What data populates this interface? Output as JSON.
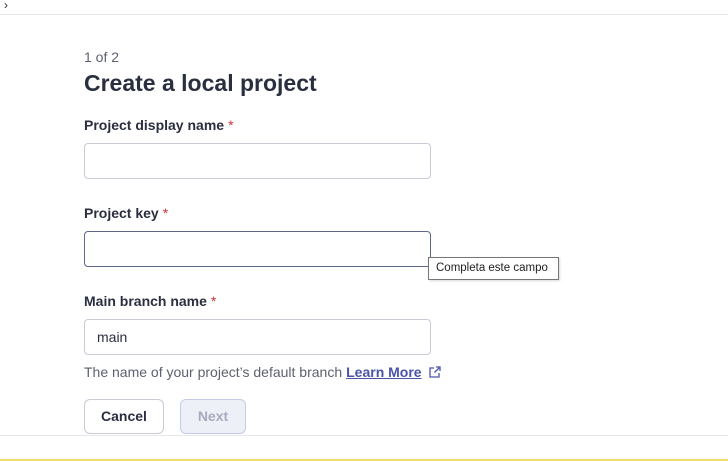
{
  "header": {
    "stub_glyph": "›"
  },
  "wizard": {
    "step": "1 of 2",
    "title": "Create a local project"
  },
  "fields": {
    "display_name": {
      "label": "Project display name",
      "required_mark": "*",
      "value": ""
    },
    "project_key": {
      "label": "Project key",
      "required_mark": "*",
      "value": "",
      "tooltip": "Completa este campo"
    },
    "main_branch": {
      "label": "Main branch name",
      "required_mark": "*",
      "value": "main",
      "help_text": "The name of your project’s default branch",
      "help_link": "Learn More"
    }
  },
  "actions": {
    "cancel_label": "Cancel",
    "next_label": "Next"
  },
  "colors": {
    "required": "#d02f3a",
    "link": "#4a54a8",
    "focus_border": "#5c6789",
    "bottom_accent": "#f2dc6a"
  },
  "icons": {
    "external_link": "external-link-icon"
  }
}
